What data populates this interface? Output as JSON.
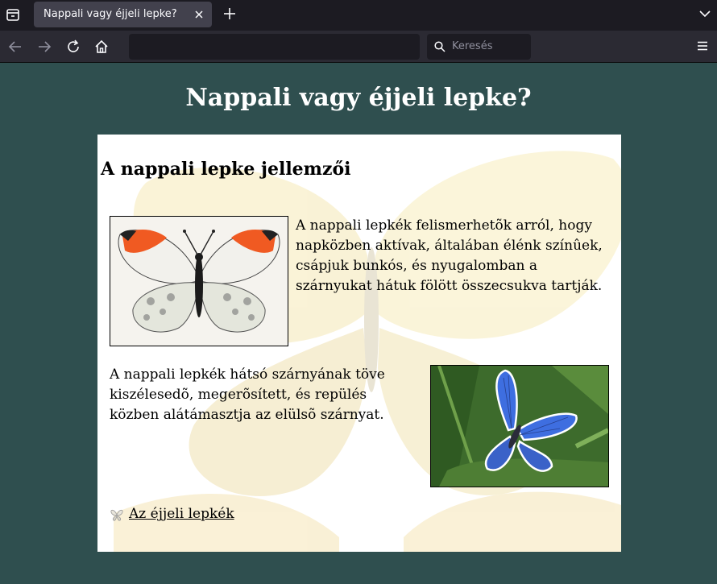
{
  "browser": {
    "tab_title": "Nappali vagy éjjeli lepke?",
    "search_placeholder": "Keresés"
  },
  "page": {
    "title": "Nappali vagy éjjeli lepke?",
    "section_heading": "A nappali lepke jellemzői",
    "paragraph1": "A nappali lepkék felismerhetõk arról, hogy napközben aktívak, általában élénk színûek, csápjuk bunkós, és nyugalomban a szárnyukat hátuk fölött összecsukva tartják.",
    "paragraph2": "A nappali lepkék hátsó szárnyának töve kiszélesedõ, megerõsített, és repülés közben alátámasztja az elülsõ szárnyat.",
    "link_text": "Az éjjeli lepkék"
  },
  "colors": {
    "page_background": "#2f4f4f",
    "content_background": "#ffffff",
    "tabbar": "#1c1b22",
    "navbar": "#2b2a33"
  }
}
